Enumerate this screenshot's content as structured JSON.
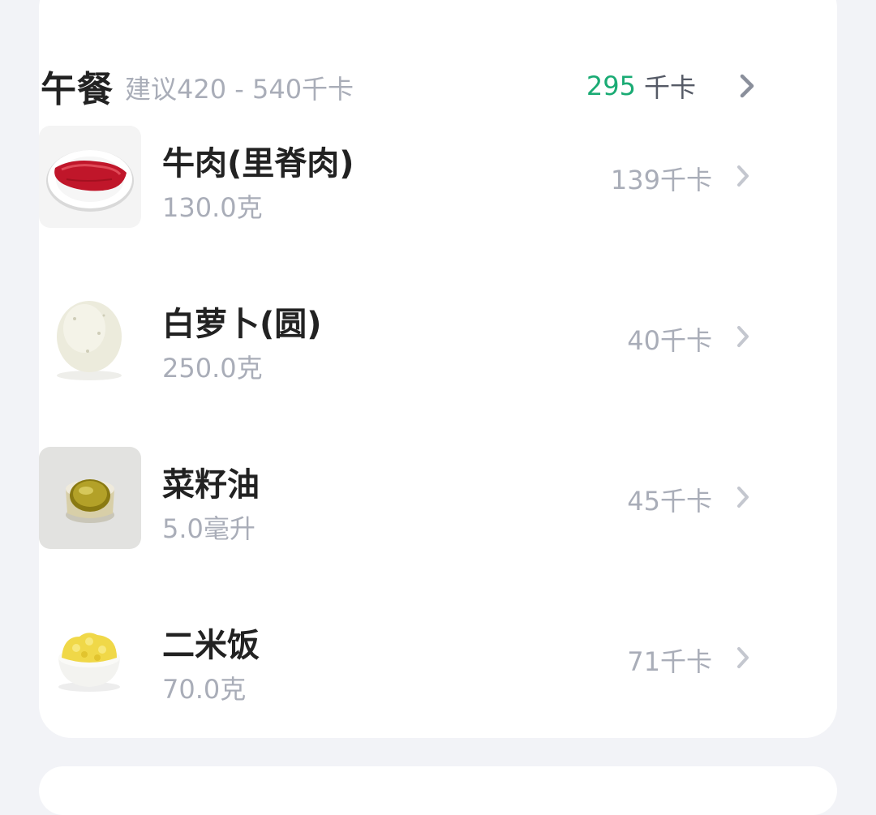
{
  "meal": {
    "title": "午餐",
    "suggestion": "建议420 - 540千卡",
    "total_kcal": "295",
    "total_unit": "千卡"
  },
  "foods": [
    {
      "name": "牛肉(里脊肉)",
      "amount": "130.0克",
      "kcal": "139千卡",
      "icon": "beef-icon"
    },
    {
      "name": "白萝卜(圆)",
      "amount": "250.0克",
      "kcal": "40千卡",
      "icon": "radish-icon"
    },
    {
      "name": "菜籽油",
      "amount": "5.0毫升",
      "kcal": "45千卡",
      "icon": "oil-icon"
    },
    {
      "name": "二米饭",
      "amount": "70.0克",
      "kcal": "71千卡",
      "icon": "rice-icon"
    }
  ],
  "colors": {
    "accent_green": "#1aab74",
    "muted_text": "#a9adb8",
    "title_text": "#222222"
  }
}
